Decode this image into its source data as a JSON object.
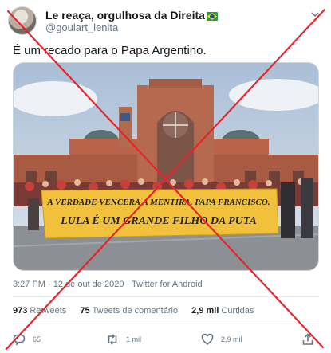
{
  "author": {
    "display_name": "Le reaça, orgulhosa da Direita",
    "handle": "@goulart_lenita"
  },
  "tweet": {
    "text": "É um recado para o Papa Argentino.",
    "timestamp": "3:27 PM · 12 de out de 2020 · Twitter for Android"
  },
  "photo": {
    "banner_line1": "A VERDADE VENCERÁ A MENTIRA. PAPA FRANCISCO.",
    "banner_line2": "LULA É UM GRANDE FILHO DA PUTA"
  },
  "stats": {
    "retweets_count": "973",
    "retweets_label": "Retweets",
    "comments_count": "75",
    "comments_label": "Tweets de comentário",
    "likes_count": "2,9 mil",
    "likes_label": "Curtidas"
  },
  "actions": {
    "reply_count": "65",
    "retweet_count": "1 mil",
    "like_count": "2,9 mil"
  },
  "overlay": {
    "cross_color": "#e8242c"
  },
  "icons": [
    "chevron-down-icon",
    "brazil-flag-icon",
    "reply-icon",
    "retweet-icon",
    "like-icon",
    "share-icon"
  ]
}
